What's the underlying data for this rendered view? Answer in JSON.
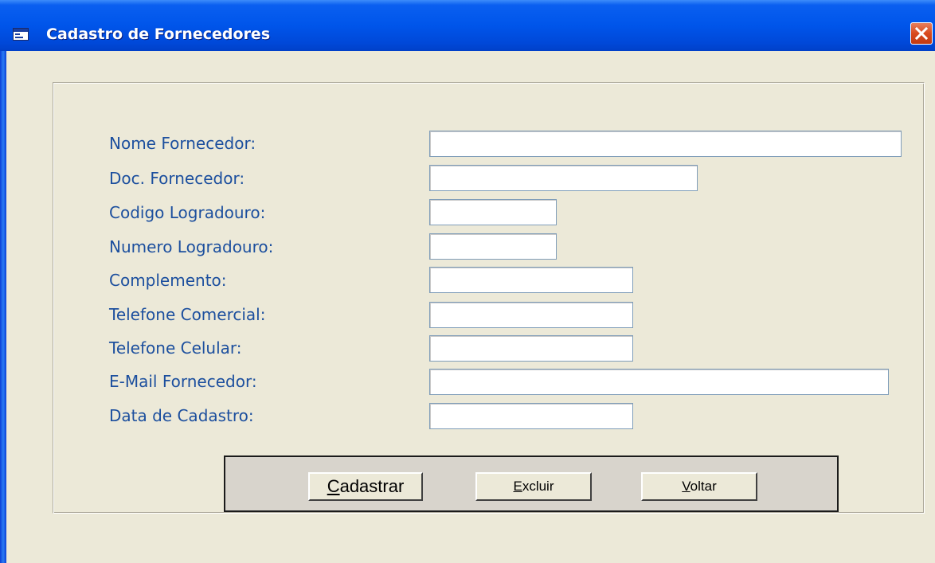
{
  "window": {
    "title": "Cadastro de Fornecedores"
  },
  "form": {
    "fields": [
      {
        "label": "Nome Fornecedor:",
        "value": ""
      },
      {
        "label": "Doc. Fornecedor:",
        "value": ""
      },
      {
        "label": "Codigo Logradouro:",
        "value": ""
      },
      {
        "label": "Numero Logradouro:",
        "value": ""
      },
      {
        "label": "Complemento:",
        "value": ""
      },
      {
        "label": "Telefone Comercial:",
        "value": ""
      },
      {
        "label": "Telefone Celular:",
        "value": ""
      },
      {
        "label": "E-Mail Fornecedor:",
        "value": ""
      },
      {
        "label": "Data de Cadastro:",
        "value": ""
      }
    ]
  },
  "buttons": {
    "cadastrar": {
      "mnemonic": "C",
      "rest": "adastrar"
    },
    "excluir": {
      "mnemonic": "E",
      "rest": "xcluir"
    },
    "voltar": {
      "mnemonic": "V",
      "rest": "oltar"
    }
  },
  "colors": {
    "titlebar": "#0055ea",
    "form_background": "#ece9d8",
    "label_text": "#1c4f9e",
    "close_button": "#d94a1e"
  }
}
